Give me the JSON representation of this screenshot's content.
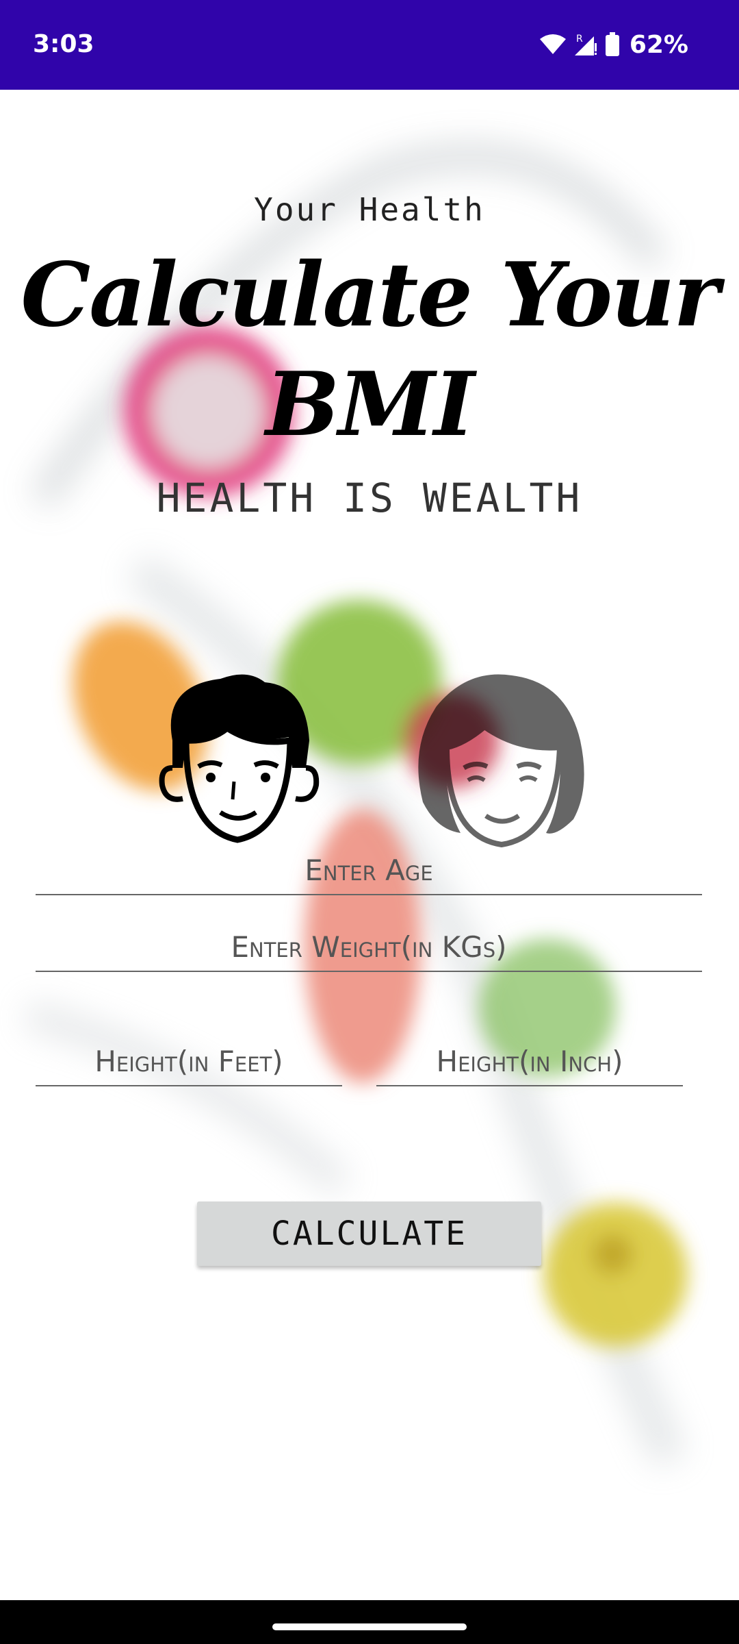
{
  "status_bar": {
    "time": "3:03",
    "battery": "62%",
    "icons": [
      "wifi-icon",
      "signal-icon",
      "battery-icon"
    ],
    "background": "#3004aa"
  },
  "header": {
    "overline": "Your Health",
    "title_line1": "Calculate Your",
    "title_line2": "BMI",
    "tagline": "HEALTH IS WEALTH"
  },
  "avatars": {
    "male": "male-avatar-icon",
    "female": "female-avatar-icon"
  },
  "form": {
    "age_placeholder": "Enter Age",
    "weight_placeholder": "Enter Weight(in KGs)",
    "height_feet_placeholder": "Height(in Feet)",
    "height_inch_placeholder": "Height(in Inch)"
  },
  "actions": {
    "calculate_label": "CALCULATE"
  }
}
